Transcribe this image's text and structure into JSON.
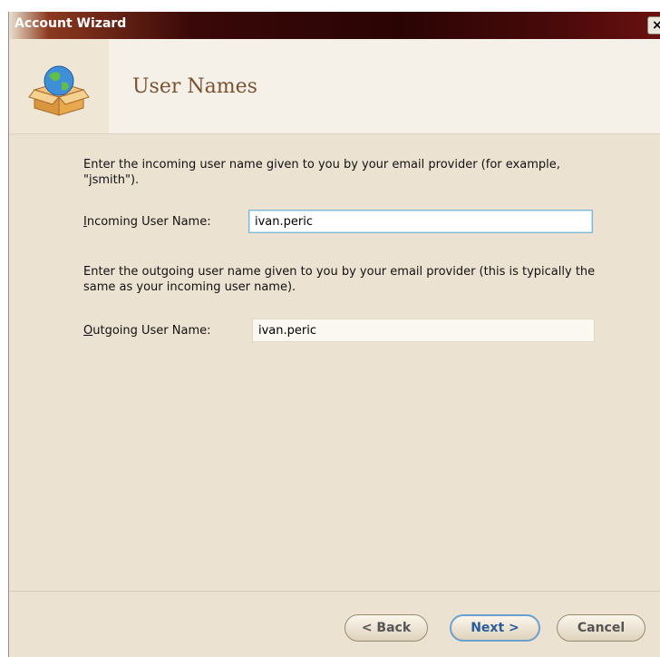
{
  "window": {
    "title": "Account Wizard",
    "close_symbol": "×"
  },
  "header": {
    "page_title": "User Names",
    "icon": "globe-in-box-icon"
  },
  "incoming": {
    "description": "Enter the incoming user name given to you by your email provider (for example, \"jsmith\").",
    "label_mnemonic": "I",
    "label_rest": "ncoming User Name:",
    "value": "ivan.peric"
  },
  "outgoing": {
    "description": "Enter the outgoing user name given to you by your email provider (this is typically the same as your incoming user name).",
    "label_mnemonic": "O",
    "label_rest": "utgoing User Name:",
    "value": "ivan.peric"
  },
  "buttons": {
    "back": "< Back",
    "next": "Next >",
    "cancel": "Cancel"
  },
  "colors": {
    "accent": "#6a9fcf",
    "title_text": "#7a5230",
    "background": "#ece2d2"
  }
}
